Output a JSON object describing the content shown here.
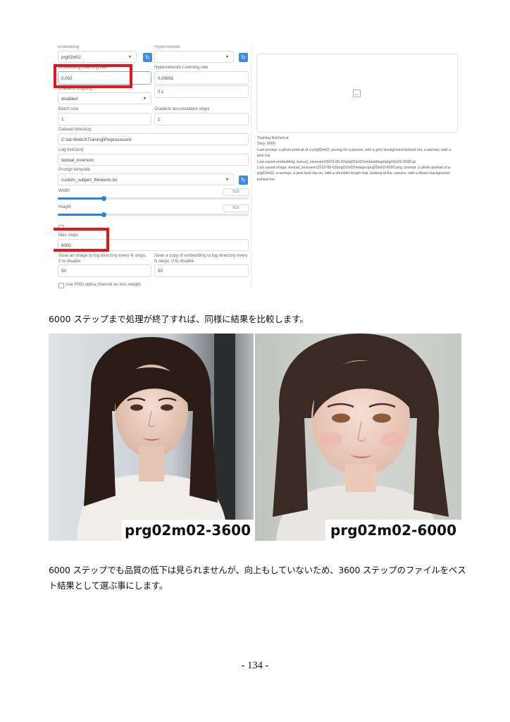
{
  "ui_screenshot": {
    "fields": {
      "embedding_label": "Embedding",
      "embedding_value": "prg02m02",
      "hypernetwork_label": "Hypernetwork",
      "embedding_lr_label": "Embedding Learning rate",
      "embedding_lr_value": "0.002",
      "hypernetwork_lr_label": "Hypernetwork Learning rate",
      "hypernetwork_lr_value": "0.00001",
      "gradient_clipping_label": "Gradient Clipping",
      "gradient_clipping_value": "disabled",
      "gradient_clipping_amount": "0.1",
      "batch_size_label": "Batch size",
      "batch_size_value": "1",
      "grad_accum_label": "Gradient accumulation steps",
      "grad_accum_value": "1",
      "dataset_dir_label": "Dataset directory",
      "dataset_dir_value": "C:\\sd-WebUI\\Training\\Preprocessed",
      "log_dir_label": "Log directory",
      "log_dir_value": "textual_inversion",
      "prompt_template_label": "Prompt template",
      "prompt_template_value": "custom_subject_filewords.txt",
      "width_label": "Width",
      "width_value": "512",
      "height_label": "Height",
      "height_value": "512",
      "max_steps_label": "Max steps",
      "max_steps_value": "6000",
      "save_image_label": "Save an image to log directory every N steps, 0 to disable",
      "save_image_value": "50",
      "save_embedding_label": "Save a copy of embedding to log directory every N steps, 0 to disable",
      "save_embedding_value": "50",
      "alpha_label": "Use PNG alpha channel as loss weight"
    },
    "log": {
      "title": "Training finished at",
      "step": "Step: 6000",
      "last_prompt": "Last prompt: a photo portrait of a prg02m02, posing for a picture, with a grey background behind her, a woman, with a pink top",
      "last_embedding": "Last saved embedding: textual_inversion\\2023-06-02\\prg02m02\\embeddings\\prg02m02-6000.pt",
      "last_image": "Last saved image: textual_inversion\\2023-06-02\\prg02m02\\images\\prg02m02-6000.png, prompt: a photo portrait of a prg02m02, a woman, a pink tank top on, with a shoulder length hair, looking at the camera, with a library background behind her"
    }
  },
  "text": {
    "para1": "6000 ステップまで処理が終了すれば、同様に結果を比較します。",
    "para2": "6000 ステップでも品質の低下は見られませんが、向上もしていないため、3600 ステップのファイルをベスト結果として選ぶ事にします。"
  },
  "photos": {
    "left_caption": "prg02m02-3600",
    "right_caption": "prg02m02-6000"
  },
  "page_number": "- 134 -",
  "colors": {
    "highlight": "#e8141b",
    "accent": "#2f7fe0"
  }
}
